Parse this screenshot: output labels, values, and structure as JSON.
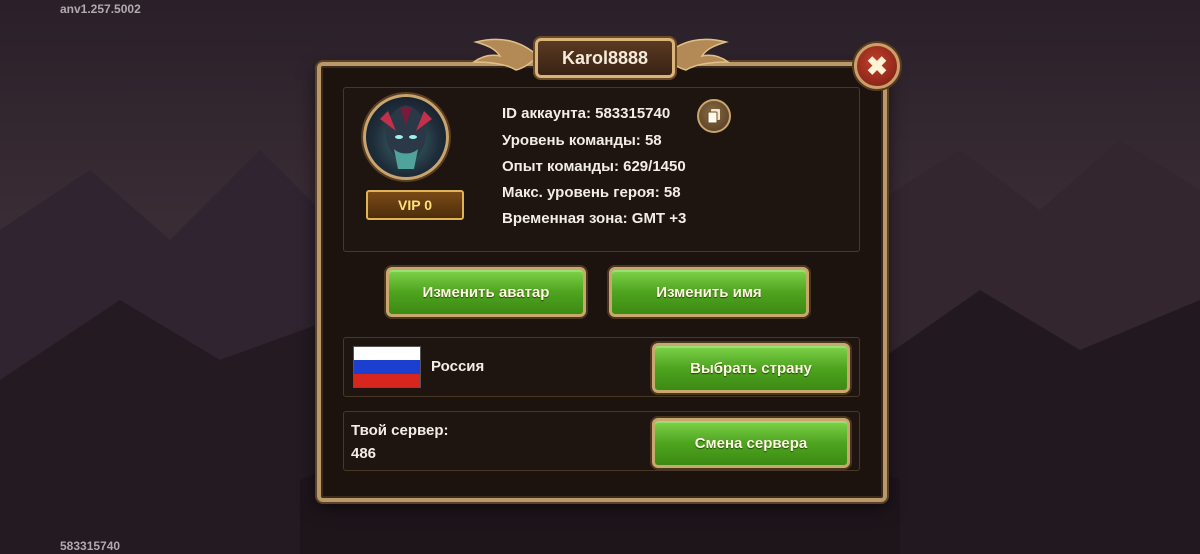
{
  "version": "anv1.257.5002",
  "bottom_id": "583315740",
  "title": "Karol8888",
  "close_icon": "close-icon",
  "profile": {
    "vip": "VIP 0",
    "lines": [
      "ID аккаунта: 583315740",
      "Уровень команды: 58",
      "Опыт команды: 629/1450",
      "Макс. уровень героя: 58",
      "Временная зона: GMT +3"
    ]
  },
  "buttons": {
    "change_avatar": "Изменить аватар",
    "change_name": "Изменить имя",
    "choose_country": "Выбрать страну",
    "change_server": "Смена сервера"
  },
  "country": {
    "name": "Россия",
    "flag_colors": [
      "#ffffff",
      "#1c3fd0",
      "#d7261e"
    ]
  },
  "server": {
    "label": "Твой сервер:",
    "value": "486"
  },
  "colors": {
    "button_green": "#4ea41f",
    "frame_gold": "#b9986a",
    "close_red": "#a8321f"
  }
}
